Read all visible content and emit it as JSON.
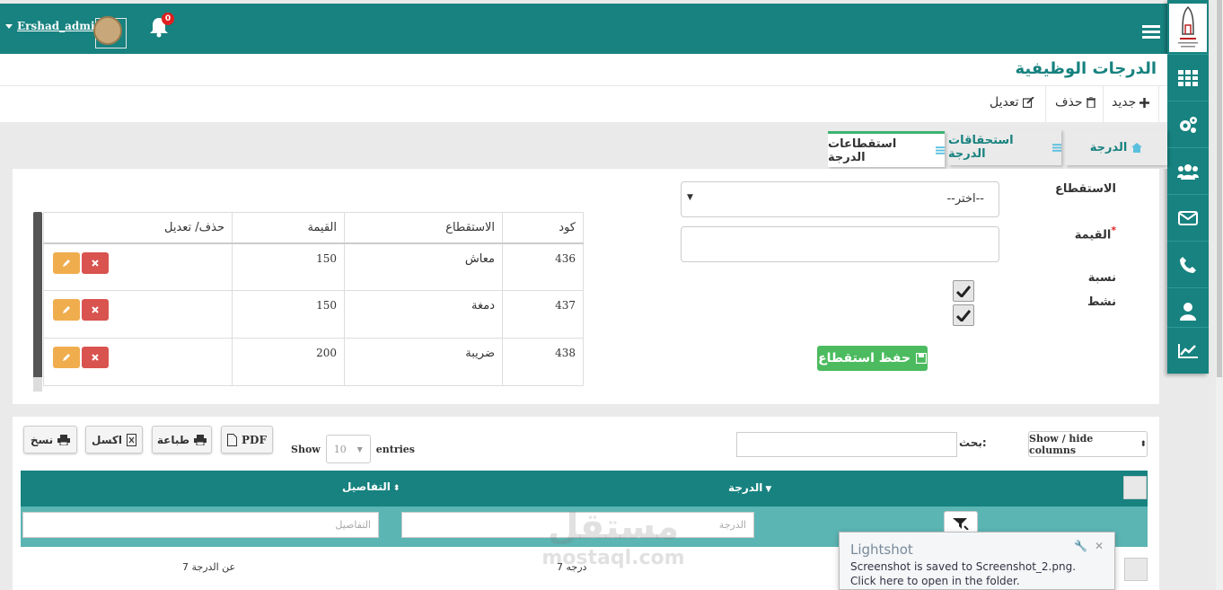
{
  "topbar": {
    "username": "Ershad_admin",
    "notification_count": "0",
    "color": "#17827f"
  },
  "page": {
    "title": "الدرجات الوظيفية"
  },
  "toolbar": {
    "new_label": "جديد",
    "delete_label": "حذف",
    "edit_label": "تعديل"
  },
  "tabs": [
    {
      "label": "الدرجة",
      "icon": "home-icon"
    },
    {
      "label": "استحقاقات الدرجة",
      "icon": "list-icon"
    },
    {
      "label": "استقطاعات الدرجة",
      "icon": "list-icon",
      "active": true
    }
  ],
  "form": {
    "deduction_label": "الاستقطاع",
    "deduction_value": "--اختر--",
    "value_label": "القيمة",
    "value_required_mark": "*",
    "ratio_label": "نسبة",
    "active_label": "نشط",
    "ratio_checked": true,
    "active_checked": true,
    "save_label": "حفظ استقطاع"
  },
  "deductions_table": {
    "headers": {
      "code": "كود",
      "deduction": "الاستقطاع",
      "value": "القيمة",
      "actions": "حذف/ تعديل"
    },
    "rows": [
      {
        "code": "436",
        "deduction": "معاش",
        "value": "150"
      },
      {
        "code": "437",
        "deduction": "دمغة",
        "value": "150"
      },
      {
        "code": "438",
        "deduction": "ضريبة",
        "value": "200"
      }
    ]
  },
  "list": {
    "export_buttons": {
      "copy": "نسخ",
      "excel": "اكسل",
      "print": "طباعة",
      "pdf": "PDF"
    },
    "show_label": "Show",
    "entries_value": "10",
    "entries_label": "entries",
    "search_label": "بحث:",
    "show_hide_label": "Show / hide columns",
    "columns": {
      "grade": "الدرجة",
      "details": "التفاصيل"
    },
    "filters": {
      "grade_placeholder": "الدرجة",
      "details_placeholder": "التفاصيل"
    },
    "rows": [
      {
        "grade": "درجه 7",
        "details": "عن الدرجة 7"
      }
    ]
  },
  "watermark": {
    "arabic": "مستقل",
    "latin": "mostaql.com"
  },
  "toast": {
    "title": "Lightshot",
    "message": "Screenshot is saved to Screenshot_2.png. Click here to open in the folder."
  },
  "sidebar": {
    "items": [
      "grid-icon",
      "gears-icon",
      "users-icon",
      "envelope-icon",
      "phone-icon",
      "user-icon",
      "chart-icon"
    ]
  }
}
